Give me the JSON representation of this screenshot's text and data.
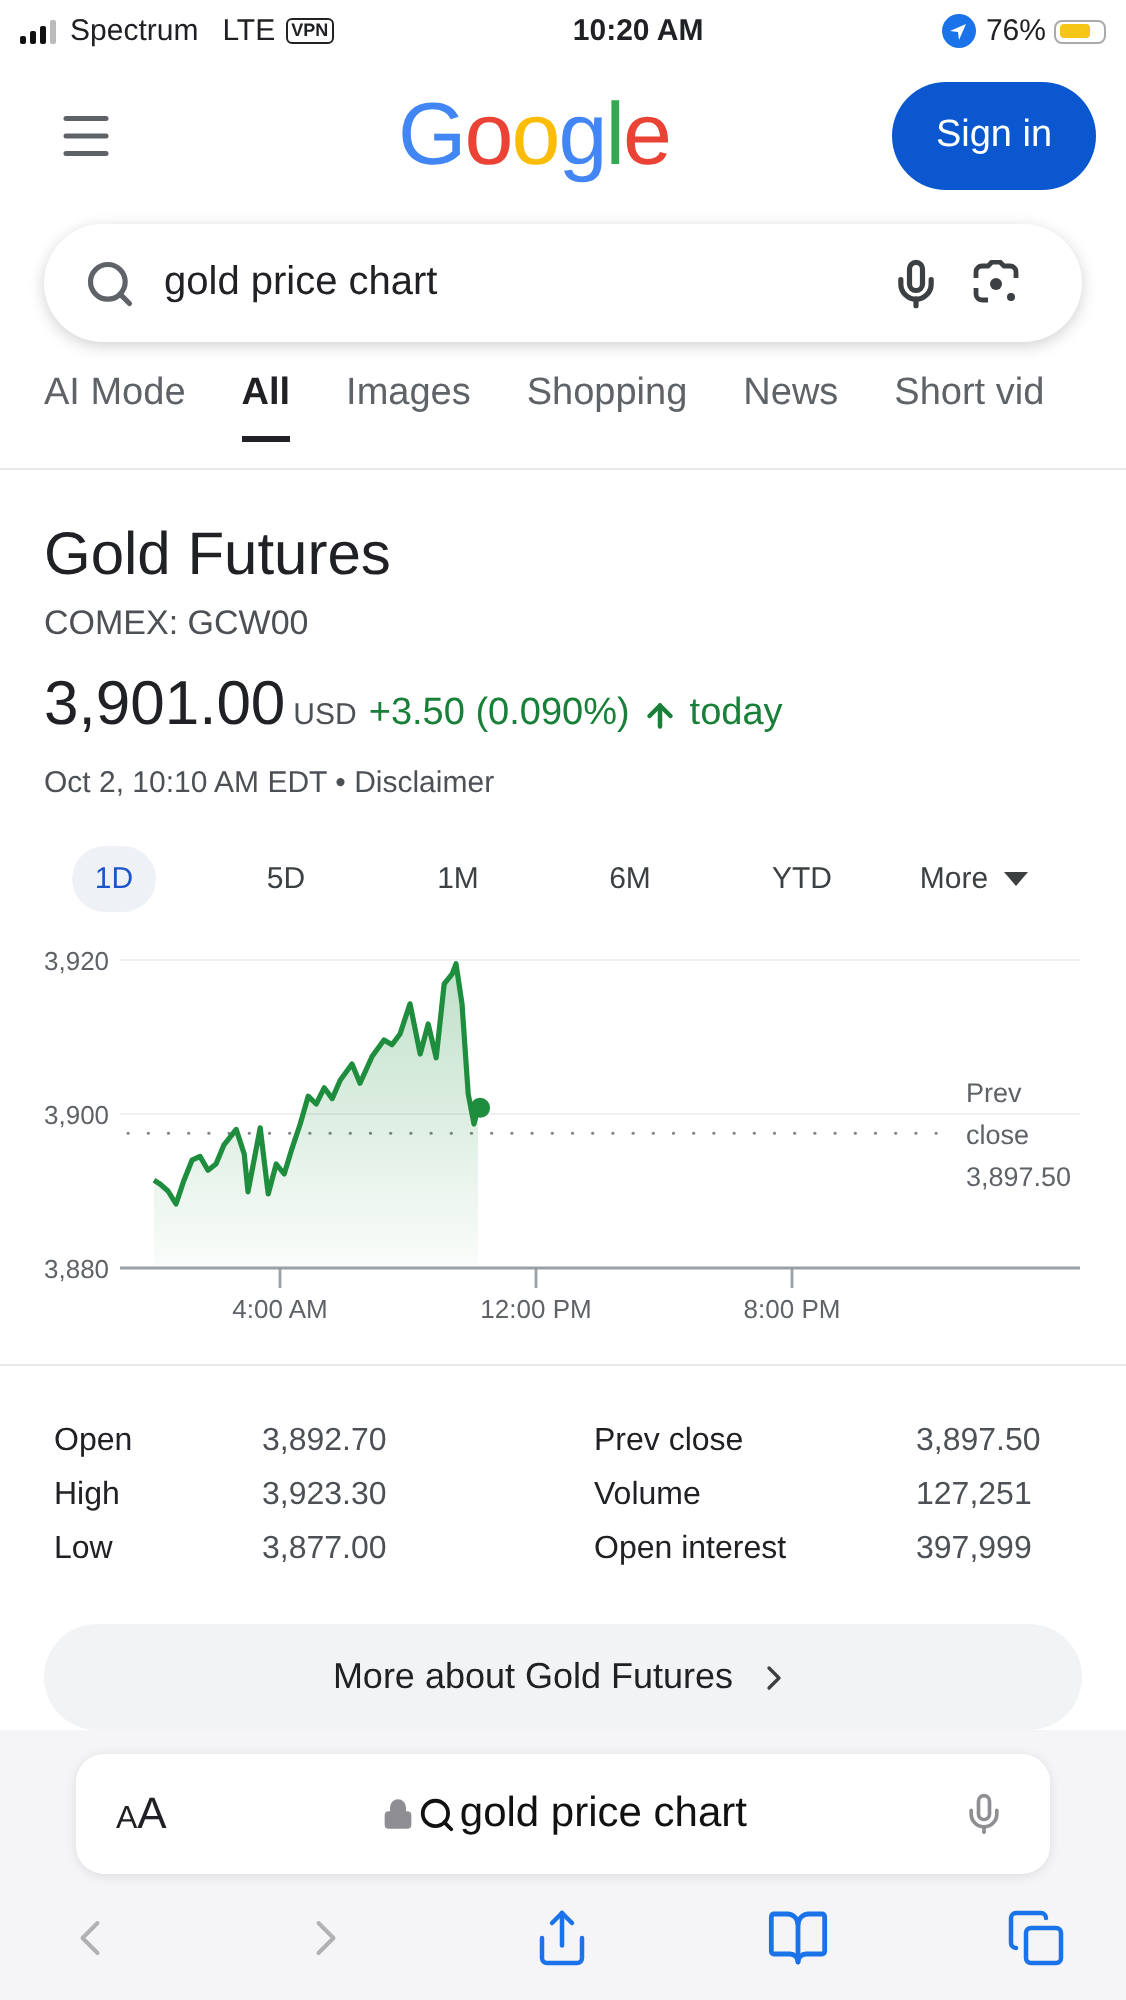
{
  "status_bar": {
    "carrier": "Spectrum",
    "network": "LTE",
    "vpn": "VPN",
    "time": "10:20 AM",
    "battery": "76%"
  },
  "header": {
    "logo": "Google",
    "sign_in": "Sign in"
  },
  "search": {
    "value": "gold price chart"
  },
  "tabs": [
    {
      "label": "AI Mode",
      "selected": false
    },
    {
      "label": "All",
      "selected": true
    },
    {
      "label": "Images",
      "selected": false
    },
    {
      "label": "Shopping",
      "selected": false
    },
    {
      "label": "News",
      "selected": false
    },
    {
      "label": "Short vid",
      "selected": false
    }
  ],
  "quote": {
    "name": "Gold Futures",
    "symbol": "COMEX: GCW00",
    "price": "3,901.00",
    "currency": "USD",
    "change": "+3.50 (0.090%)",
    "up": true,
    "period": "today",
    "timestamp": "Oct 2, 10:10 AM EDT",
    "separator": "•",
    "disclaimer": "Disclaimer"
  },
  "ranges": [
    {
      "label": "1D",
      "selected": true
    },
    {
      "label": "5D",
      "selected": false
    },
    {
      "label": "1M",
      "selected": false
    },
    {
      "label": "6M",
      "selected": false
    },
    {
      "label": "YTD",
      "selected": false
    },
    {
      "label": "More",
      "selected": false,
      "kind": "dropdown"
    }
  ],
  "chart_data": {
    "type": "area",
    "xlim": [
      -1,
      29
    ],
    "ylim": [
      3880,
      3920
    ],
    "xticks": [
      {
        "value": 4,
        "label": "4:00 AM"
      },
      {
        "value": 12,
        "label": "12:00 PM"
      },
      {
        "value": 20,
        "label": "8:00 PM"
      }
    ],
    "yticks": [
      {
        "value": 3880,
        "label": "3,880"
      },
      {
        "value": 3900,
        "label": "3,900"
      },
      {
        "value": 3920,
        "label": "3,920"
      }
    ],
    "x": [
      0.06,
      0.25,
      0.5,
      0.75,
      1,
      1.25,
      1.5,
      1.75,
      2,
      2.25,
      2.63,
      2.88,
      3,
      3.38,
      3.63,
      3.88,
      4.13,
      4.38,
      4.63,
      4.88,
      5.13,
      5.38,
      5.63,
      5.88,
      6.25,
      6.5,
      6.88,
      7.25,
      7.5,
      7.75,
      8.06,
      8.38,
      8.63,
      8.88,
      9.13,
      9.38,
      9.5,
      9.69,
      9.88,
      10.06,
      10.19
    ],
    "series": [
      {
        "color": "#1e8e3e",
        "values": [
          3891.4,
          3890.9,
          3890,
          3888.3,
          3891.4,
          3894,
          3894.5,
          3892.7,
          3893.5,
          3896,
          3898,
          3894.8,
          3889.9,
          3898.2,
          3889.6,
          3893.5,
          3892.2,
          3895.6,
          3898.7,
          3902.3,
          3901.3,
          3903.4,
          3902,
          3904.4,
          3906.5,
          3904,
          3907.5,
          3909.6,
          3909,
          3910.4,
          3914.3,
          3907.8,
          3911.7,
          3907.3,
          3916.9,
          3918.2,
          3919.5,
          3914.3,
          3902.6,
          3898.7,
          3900.8
        ]
      }
    ],
    "ref_lines": [
      {
        "axis": "y",
        "value": 3897.5,
        "label": "Prev close 3,897.50"
      }
    ]
  },
  "stats": [
    [
      {
        "label": "Open",
        "value": "3,892.70"
      },
      {
        "label": "High",
        "value": "3,923.30"
      },
      {
        "label": "Low",
        "value": "3,877.00"
      }
    ],
    [
      {
        "label": "Prev close",
        "value": "3,897.50"
      },
      {
        "label": "Volume",
        "value": "127,251"
      },
      {
        "label": "Open interest",
        "value": "397,999"
      }
    ]
  ],
  "more_button": "More about Gold Futures",
  "browser": {
    "text_size": "AA",
    "address": "gold price chart",
    "back_disabled": true,
    "forward_disabled": true
  }
}
